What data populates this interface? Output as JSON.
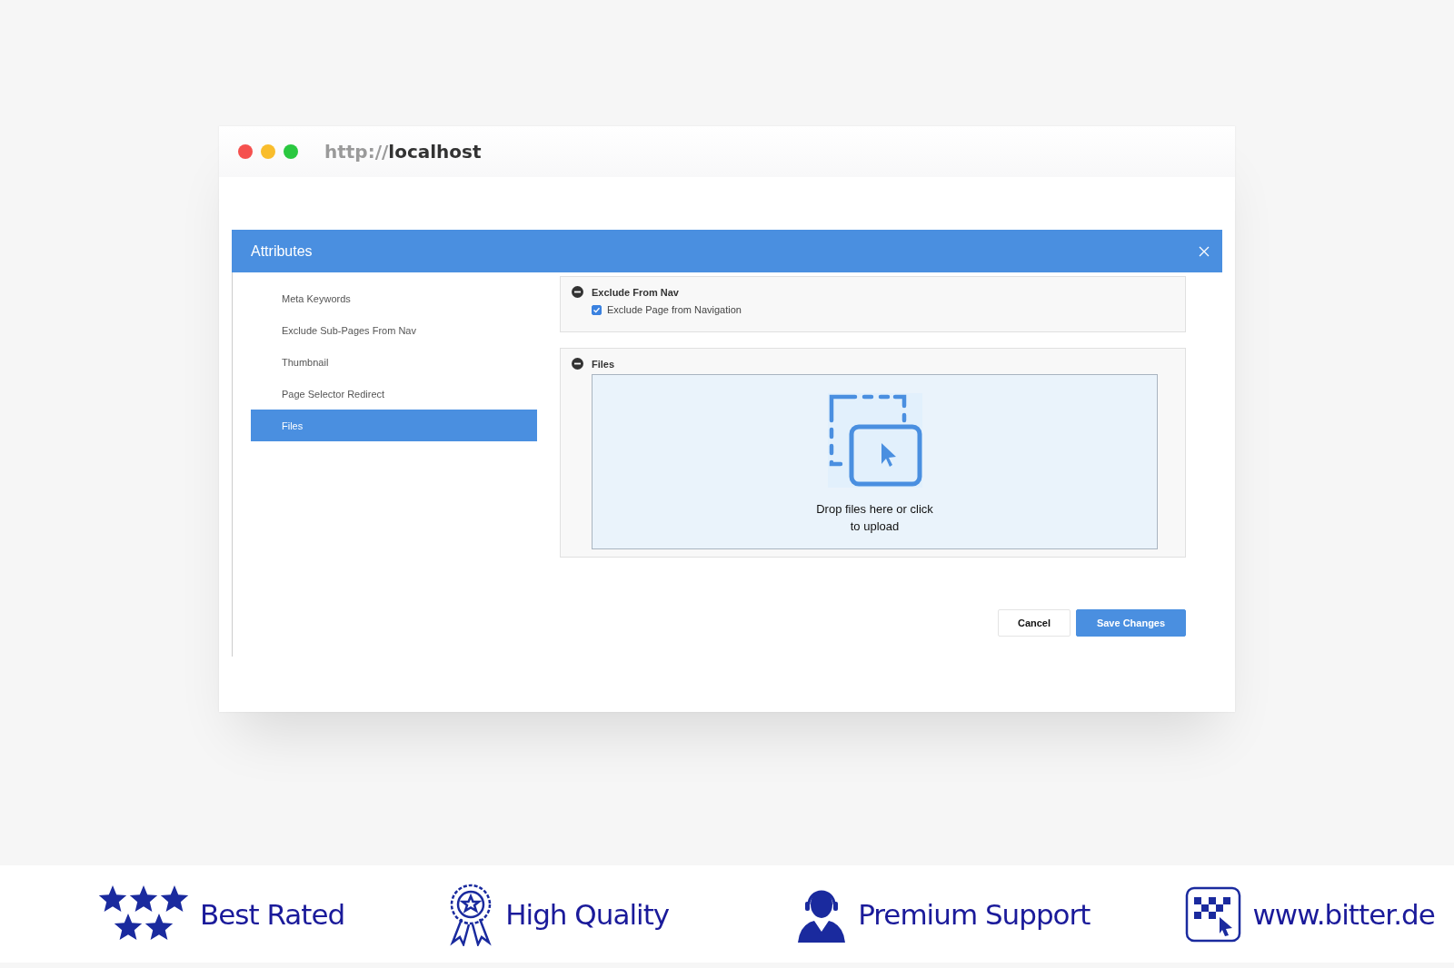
{
  "browser": {
    "url_scheme": "http://",
    "url_host": "localhost"
  },
  "modal": {
    "title": "Attributes"
  },
  "sidebar": {
    "items": [
      {
        "label": "Meta Keywords",
        "selected": false
      },
      {
        "label": "Exclude Sub-Pages From Nav",
        "selected": false
      },
      {
        "label": "Thumbnail",
        "selected": false
      },
      {
        "label": "Page Selector Redirect",
        "selected": false
      },
      {
        "label": "Files",
        "selected": true
      }
    ]
  },
  "sections": [
    {
      "kind": "checkbox",
      "title": "Exclude From Nav",
      "option": {
        "label": "Exclude Page from Navigation",
        "checked": true
      }
    },
    {
      "kind": "dropzone",
      "title": "Files",
      "prompt": "Drop files here or click to upload"
    }
  ],
  "buttons": [
    {
      "kind": "secondary",
      "label": "Cancel"
    },
    {
      "kind": "primary",
      "label": "Save Changes"
    }
  ],
  "banner": [
    {
      "kind": "stars",
      "label": "Best Rated"
    },
    {
      "kind": "award",
      "label": "High Quality"
    },
    {
      "kind": "support",
      "label": "Premium Support"
    },
    {
      "kind": "logo",
      "label": "www.bitter.de"
    }
  ]
}
